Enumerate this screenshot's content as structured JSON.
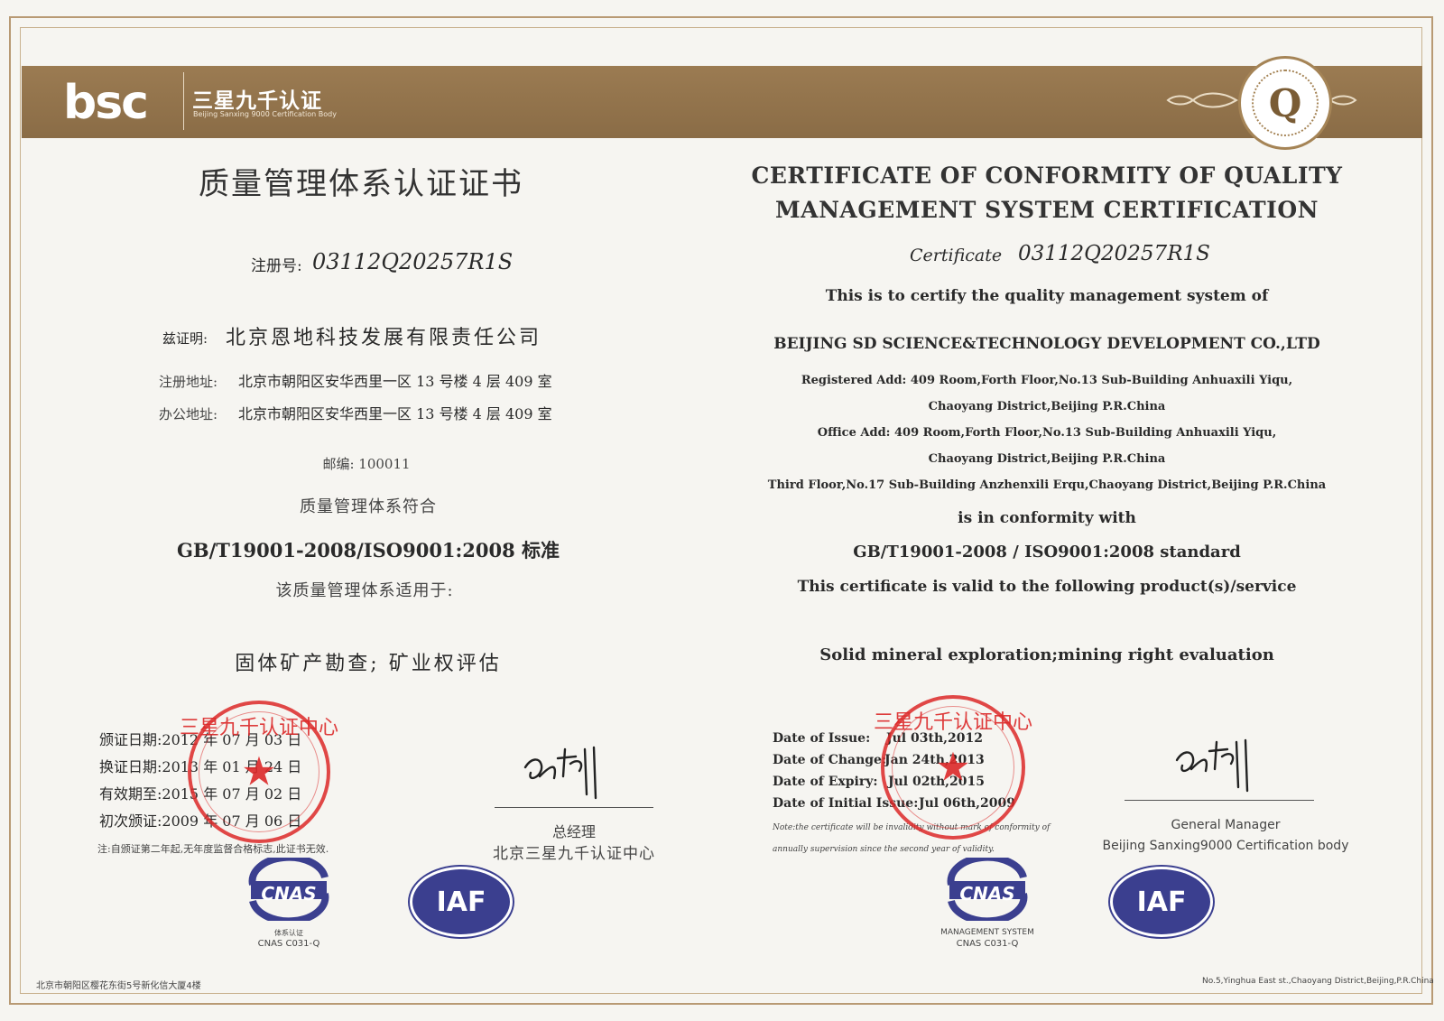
{
  "header": {
    "logo": "bsc",
    "brand_cn": "三星九千认证",
    "brand_en": "Beijing Sanxing 9000 Certification Body",
    "emblem": "Q"
  },
  "cn": {
    "title": "质量管理体系认证证书",
    "reg_label": "注册号:",
    "reg_no": "03112Q20257R1S",
    "certify_label": "兹证明:",
    "company": "北京恩地科技发展有限责任公司",
    "reg_addr_label": "注册地址:",
    "reg_addr": "北京市朝阳区安华西里一区 13 号楼 4 层 409 室",
    "office_addr_label": "办公地址:",
    "office_addr": "北京市朝阳区安华西里一区 13 号楼 4 层 409 室",
    "postcode": "邮编: 100011",
    "conform": "质量管理体系符合",
    "standard": "GB/T19001-2008/ISO9001:2008 标准",
    "scope_intro": "该质量管理体系适用于:",
    "scope": "固体矿产勘查; 矿业权评估",
    "issue": "颁证日期:2012 年 07 月 03 日",
    "change": "换证日期:2013 年 01 月 24 日",
    "expiry": "有效期至:2015 年 07 月 02 日",
    "initial": "初次颁证:2009 年 07 月 06 日",
    "note": "注:自颁证第二年起,无年度监督合格标志,此证书无效.",
    "signer_title": "总经理",
    "signer_org": "北京三星九千认证中心",
    "cnas_cn": "体系认证",
    "cnas_code": "CNAS C031-Q",
    "footer_addr": "北京市朝阳区樱花东街5号新化信大厦4楼"
  },
  "en": {
    "title_line1": "CERTIFICATE OF CONFORMITY OF QUALITY",
    "title_line2": "MANAGEMENT SYSTEM CERTIFICATION",
    "cert_label": "Certificate",
    "cert_no": "03112Q20257R1S",
    "intro": "This is to certify the quality management system of",
    "company": "BEIJING SD SCIENCE&TECHNOLOGY DEVELOPMENT CO.,LTD",
    "reg_addr_1": "Registered Add: 409 Room,Forth Floor,No.13 Sub-Building Anhuaxili Yiqu,",
    "reg_addr_2": "Chaoyang District,Beijing P.R.China",
    "office_addr_1": "Office Add: 409 Room,Forth Floor,No.13 Sub-Building Anhuaxili Yiqu,",
    "office_addr_2": "Chaoyang District,Beijing P.R.China",
    "office_addr_3": "Third Floor,No.17 Sub-Building Anzhenxili Erqu,Chaoyang District,Beijing P.R.China",
    "conform": "is in conformity with",
    "standard": "GB/T19001-2008 / ISO9001:2008 standard",
    "valid_for": "This certificate is valid to the following product(s)/service",
    "scope": "Solid mineral exploration;mining right evaluation",
    "issue_label": "Date of Issue:",
    "issue": "Jul 03th,2012",
    "change_label": "Date of Change:",
    "change": "Jan 24th,2013",
    "expiry_label": "Date of Expiry:",
    "expiry": "Jul 02th,2015",
    "initial_label": "Date of Initial Issue:",
    "initial": "Jul 06th,2009",
    "note_1": "Note:the certificate will be invalidity without mark of conformity of",
    "note_2": "annually supervision since the second year of validity.",
    "signer_title": "General Manager",
    "signer_org": "Beijing Sanxing9000 Certification body",
    "cnas_label": "MANAGEMENT SYSTEM",
    "cnas_code": "CNAS C031-Q",
    "footer_addr": "No.5,Yinghua East st.,Chaoyang District,Beijing,P.R.China"
  },
  "stamp_text": "三星九千认证中心",
  "cnas_logo": "CNAS",
  "iaf_logo": "IAF",
  "colors": {
    "banner": "#8f7049",
    "stamp": "#dc2828",
    "iaf": "#3b3f8f"
  }
}
